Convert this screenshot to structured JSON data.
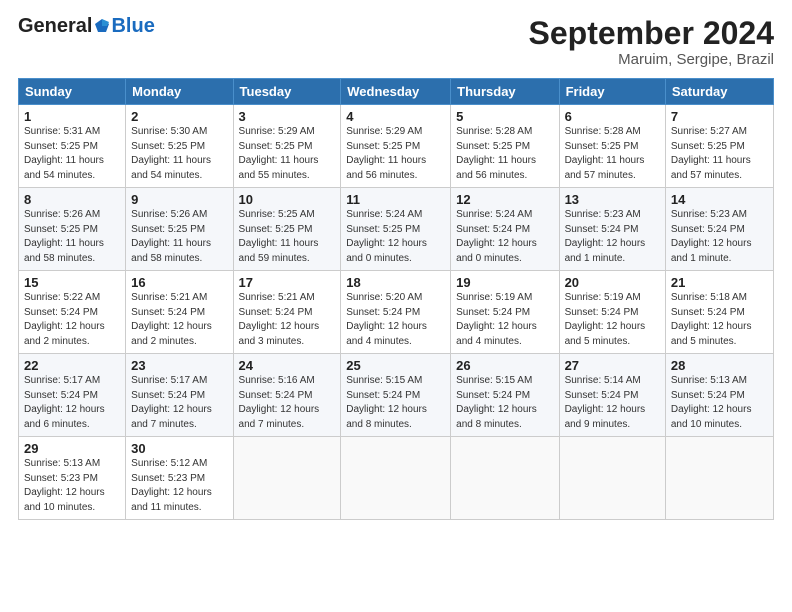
{
  "header": {
    "logo_general": "General",
    "logo_blue": "Blue",
    "month_title": "September 2024",
    "location": "Maruim, Sergipe, Brazil"
  },
  "days_of_week": [
    "Sunday",
    "Monday",
    "Tuesday",
    "Wednesday",
    "Thursday",
    "Friday",
    "Saturday"
  ],
  "weeks": [
    [
      {
        "day": "1",
        "info": "Sunrise: 5:31 AM\nSunset: 5:25 PM\nDaylight: 11 hours\nand 54 minutes."
      },
      {
        "day": "2",
        "info": "Sunrise: 5:30 AM\nSunset: 5:25 PM\nDaylight: 11 hours\nand 54 minutes."
      },
      {
        "day": "3",
        "info": "Sunrise: 5:29 AM\nSunset: 5:25 PM\nDaylight: 11 hours\nand 55 minutes."
      },
      {
        "day": "4",
        "info": "Sunrise: 5:29 AM\nSunset: 5:25 PM\nDaylight: 11 hours\nand 56 minutes."
      },
      {
        "day": "5",
        "info": "Sunrise: 5:28 AM\nSunset: 5:25 PM\nDaylight: 11 hours\nand 56 minutes."
      },
      {
        "day": "6",
        "info": "Sunrise: 5:28 AM\nSunset: 5:25 PM\nDaylight: 11 hours\nand 57 minutes."
      },
      {
        "day": "7",
        "info": "Sunrise: 5:27 AM\nSunset: 5:25 PM\nDaylight: 11 hours\nand 57 minutes."
      }
    ],
    [
      {
        "day": "8",
        "info": "Sunrise: 5:26 AM\nSunset: 5:25 PM\nDaylight: 11 hours\nand 58 minutes."
      },
      {
        "day": "9",
        "info": "Sunrise: 5:26 AM\nSunset: 5:25 PM\nDaylight: 11 hours\nand 58 minutes."
      },
      {
        "day": "10",
        "info": "Sunrise: 5:25 AM\nSunset: 5:25 PM\nDaylight: 11 hours\nand 59 minutes."
      },
      {
        "day": "11",
        "info": "Sunrise: 5:24 AM\nSunset: 5:25 PM\nDaylight: 12 hours\nand 0 minutes."
      },
      {
        "day": "12",
        "info": "Sunrise: 5:24 AM\nSunset: 5:24 PM\nDaylight: 12 hours\nand 0 minutes."
      },
      {
        "day": "13",
        "info": "Sunrise: 5:23 AM\nSunset: 5:24 PM\nDaylight: 12 hours\nand 1 minute."
      },
      {
        "day": "14",
        "info": "Sunrise: 5:23 AM\nSunset: 5:24 PM\nDaylight: 12 hours\nand 1 minute."
      }
    ],
    [
      {
        "day": "15",
        "info": "Sunrise: 5:22 AM\nSunset: 5:24 PM\nDaylight: 12 hours\nand 2 minutes."
      },
      {
        "day": "16",
        "info": "Sunrise: 5:21 AM\nSunset: 5:24 PM\nDaylight: 12 hours\nand 2 minutes."
      },
      {
        "day": "17",
        "info": "Sunrise: 5:21 AM\nSunset: 5:24 PM\nDaylight: 12 hours\nand 3 minutes."
      },
      {
        "day": "18",
        "info": "Sunrise: 5:20 AM\nSunset: 5:24 PM\nDaylight: 12 hours\nand 4 minutes."
      },
      {
        "day": "19",
        "info": "Sunrise: 5:19 AM\nSunset: 5:24 PM\nDaylight: 12 hours\nand 4 minutes."
      },
      {
        "day": "20",
        "info": "Sunrise: 5:19 AM\nSunset: 5:24 PM\nDaylight: 12 hours\nand 5 minutes."
      },
      {
        "day": "21",
        "info": "Sunrise: 5:18 AM\nSunset: 5:24 PM\nDaylight: 12 hours\nand 5 minutes."
      }
    ],
    [
      {
        "day": "22",
        "info": "Sunrise: 5:17 AM\nSunset: 5:24 PM\nDaylight: 12 hours\nand 6 minutes."
      },
      {
        "day": "23",
        "info": "Sunrise: 5:17 AM\nSunset: 5:24 PM\nDaylight: 12 hours\nand 7 minutes."
      },
      {
        "day": "24",
        "info": "Sunrise: 5:16 AM\nSunset: 5:24 PM\nDaylight: 12 hours\nand 7 minutes."
      },
      {
        "day": "25",
        "info": "Sunrise: 5:15 AM\nSunset: 5:24 PM\nDaylight: 12 hours\nand 8 minutes."
      },
      {
        "day": "26",
        "info": "Sunrise: 5:15 AM\nSunset: 5:24 PM\nDaylight: 12 hours\nand 8 minutes."
      },
      {
        "day": "27",
        "info": "Sunrise: 5:14 AM\nSunset: 5:24 PM\nDaylight: 12 hours\nand 9 minutes."
      },
      {
        "day": "28",
        "info": "Sunrise: 5:13 AM\nSunset: 5:24 PM\nDaylight: 12 hours\nand 10 minutes."
      }
    ],
    [
      {
        "day": "29",
        "info": "Sunrise: 5:13 AM\nSunset: 5:23 PM\nDaylight: 12 hours\nand 10 minutes."
      },
      {
        "day": "30",
        "info": "Sunrise: 5:12 AM\nSunset: 5:23 PM\nDaylight: 12 hours\nand 11 minutes."
      },
      {
        "day": "",
        "info": ""
      },
      {
        "day": "",
        "info": ""
      },
      {
        "day": "",
        "info": ""
      },
      {
        "day": "",
        "info": ""
      },
      {
        "day": "",
        "info": ""
      }
    ]
  ]
}
